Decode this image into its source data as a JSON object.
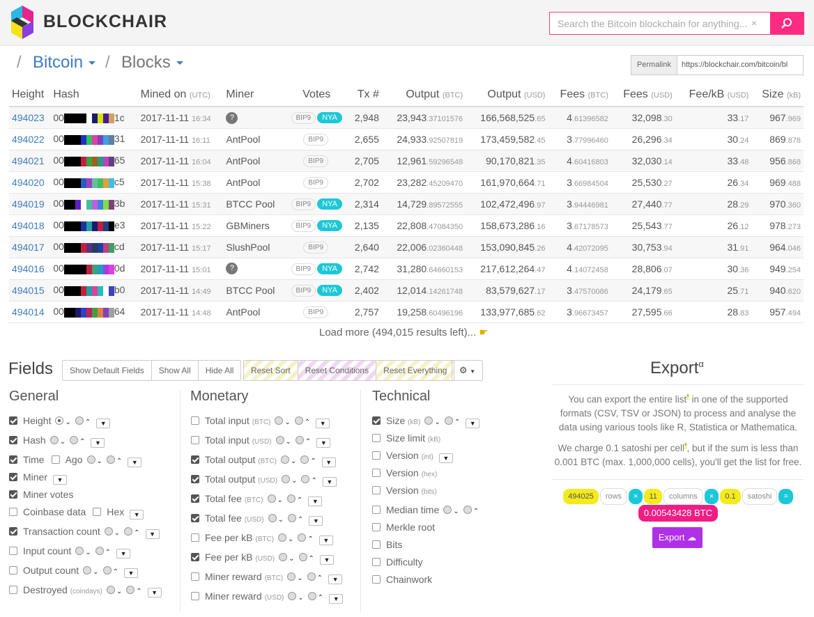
{
  "header": {
    "brand": "BLOCKCHAIR",
    "search_placeholder": "Search the Bitcoin blockchain for anything...",
    "clear": "×"
  },
  "breadcrumb": {
    "sep1": "/",
    "chain": "Bitcoin",
    "sep2": "/",
    "section": "Blocks"
  },
  "permalink": {
    "label": "Permalink",
    "url": "https://blockchair.com/bitcoin/bl"
  },
  "table": {
    "headers": [
      {
        "t": "Height",
        "u": ""
      },
      {
        "t": "Hash",
        "u": ""
      },
      {
        "t": "Mined on ",
        "u": "(UTC)"
      },
      {
        "t": "Miner",
        "u": ""
      },
      {
        "t": "Votes",
        "u": ""
      },
      {
        "t": "Tx #",
        "u": ""
      },
      {
        "t": "Output ",
        "u": "(BTC)"
      },
      {
        "t": "Output ",
        "u": "(USD)"
      },
      {
        "t": "Fees ",
        "u": "(BTC)"
      },
      {
        "t": "Fees ",
        "u": "(USD)"
      },
      {
        "t": "Fee/kB ",
        "u": "(USD)"
      },
      {
        "t": "Size ",
        "u": "(kB)"
      }
    ],
    "rows": [
      {
        "height": "494023",
        "hp": "00",
        "hs": "1c",
        "date": "2017-11-11",
        "time": "16:34",
        "miner": "?",
        "bip": "BIP9",
        "nya": "NYA",
        "tx": "2,948",
        "obi": "23,943",
        "obf": ".37101576",
        "oui": "166,568,525",
        "ouf": ".65",
        "fbi": "4",
        "fbf": ".61396582",
        "fui": "32,098",
        "fuf": ".30",
        "fki": "33",
        "fkf": ".17",
        "si": "967",
        "sf": ".969",
        "colors": [
          "#000",
          "#000",
          "#000",
          "#000",
          "#fff",
          "#1a1a6e",
          "#d4e000",
          "#4a1a8e",
          "#d4a060"
        ]
      },
      {
        "height": "494022",
        "hp": "00",
        "hs": "31",
        "date": "2017-11-11",
        "time": "16:11",
        "miner": "AntPool",
        "bip": "BIP9",
        "nya": "",
        "tx": "2,655",
        "obi": "24,933",
        "obf": ".92507819",
        "oui": "173,459,582",
        "ouf": ".45",
        "fbi": "3",
        "fbf": ".77996460",
        "fui": "26,296",
        "fuf": ".34",
        "fki": "30",
        "fkf": ".24",
        "si": "869",
        "sf": ".878",
        "colors": [
          "#000",
          "#000",
          "#000",
          "#2030c0",
          "#30c060",
          "#e040a0",
          "#8040c0",
          "#40a0e0",
          "#6080a0"
        ]
      },
      {
        "height": "494021",
        "hp": "00",
        "hs": "65",
        "date": "2017-11-11",
        "time": "16:04",
        "miner": "AntPool",
        "bip": "BIP9",
        "nya": "",
        "tx": "2,705",
        "obi": "12,961",
        "obf": ".59296548",
        "oui": "90,170,821",
        "ouf": ".35",
        "fbi": "4",
        "fbf": ".60416803",
        "fui": "32,030",
        "fuf": ".14",
        "fki": "33",
        "fkf": ".48",
        "si": "956",
        "sf": ".868",
        "colors": [
          "#000",
          "#000",
          "#000",
          "#c02040",
          "#40a040",
          "#a06020",
          "#20a080",
          "#c040c0",
          "#604080"
        ]
      },
      {
        "height": "494020",
        "hp": "00",
        "hs": "c5",
        "date": "2017-11-11",
        "time": "15:38",
        "miner": "AntPool",
        "bip": "BIP9",
        "nya": "",
        "tx": "2,702",
        "obi": "23,282",
        "obf": ".45209470",
        "oui": "161,970,664",
        "ouf": ".71",
        "fbi": "3",
        "fbf": ".66984504",
        "fui": "25,530",
        "fuf": ".27",
        "fki": "26",
        "fkf": ".34",
        "si": "969",
        "sf": ".488",
        "colors": [
          "#000",
          "#000",
          "#000",
          "#2060c0",
          "#a040c0",
          "#60c0a0",
          "#40c060",
          "#e0a040",
          "#40c0e0"
        ]
      },
      {
        "height": "494019",
        "hp": "00",
        "hs": "3b",
        "date": "2017-11-11",
        "time": "15:31",
        "miner": "BTCC Pool",
        "bip": "BIP9",
        "nya": "NYA",
        "tx": "2,314",
        "obi": "14,729",
        "obf": ".89572555",
        "oui": "102,472,496",
        "ouf": ".97",
        "fbi": "3",
        "fbf": ".94446981",
        "fui": "27,440",
        "fuf": ".77",
        "fki": "28",
        "fkf": ".29",
        "si": "970",
        "sf": ".360",
        "colors": [
          "#000",
          "#000",
          "#6020c0",
          "#fff",
          "#40c0a0",
          "#c060e0",
          "#4080e0",
          "#80e040",
          "#804080"
        ]
      },
      {
        "height": "494018",
        "hp": "00",
        "hs": "e3",
        "date": "2017-11-11",
        "time": "15:22",
        "miner": "GBMiners",
        "bip": "BIP9",
        "nya": "NYA",
        "tx": "2,135",
        "obi": "22,808",
        "obf": ".47084350",
        "oui": "158,673,286",
        "ouf": ".16",
        "fbi": "3",
        "fbf": ".67178573",
        "fui": "25,543",
        "fuf": ".77",
        "fki": "26",
        "fkf": ".12",
        "si": "978",
        "sf": ".273",
        "colors": [
          "#000",
          "#000",
          "#000",
          "#2030a0",
          "#20a0a0",
          "#1a1a6e",
          "#c02040",
          "#204080",
          "#000"
        ]
      },
      {
        "height": "494017",
        "hp": "00",
        "hs": "cd",
        "date": "2017-11-11",
        "time": "15:17",
        "miner": "SlushPool",
        "bip": "BIP9",
        "nya": "",
        "tx": "2,640",
        "obi": "22,006",
        "obf": ".02360448",
        "oui": "153,090,845",
        "ouf": ".26",
        "fbi": "4",
        "fbf": ".42072095",
        "fui": "30,753",
        "fuf": ".94",
        "fki": "31",
        "fkf": ".91",
        "si": "964",
        "sf": ".046",
        "colors": [
          "#000",
          "#000",
          "#000",
          "#c02040",
          "#603080",
          "#204060",
          "#2040a0",
          "#c04080",
          "#40a060"
        ]
      },
      {
        "height": "494016",
        "hp": "00",
        "hs": "0d",
        "date": "2017-11-11",
        "time": "15:01",
        "miner": "?",
        "bip": "BIP9",
        "nya": "NYA",
        "tx": "2,742",
        "obi": "31,280",
        "obf": ".64660153",
        "oui": "217,612,264",
        "ouf": ".47",
        "fbi": "4",
        "fbf": ".14072458",
        "fui": "28,806",
        "fuf": ".07",
        "fki": "30",
        "fkf": ".36",
        "si": "949",
        "sf": ".254",
        "colors": [
          "#000",
          "#000",
          "#000",
          "#000",
          "#c02040",
          "#40a080",
          "#20a0c0",
          "#a040e0",
          "#e040e0"
        ]
      },
      {
        "height": "494015",
        "hp": "00",
        "hs": "b0",
        "date": "2017-11-11",
        "time": "14:49",
        "miner": "BTCC Pool",
        "bip": "BIP9",
        "nya": "NYA",
        "tx": "2,402",
        "obi": "12,014",
        "obf": ".14261748",
        "oui": "83,579,627",
        "ouf": ".17",
        "fbi": "3",
        "fbf": ".47570086",
        "fui": "24,179",
        "fuf": ".65",
        "fki": "25",
        "fkf": ".71",
        "si": "940",
        "sf": ".620",
        "colors": [
          "#000",
          "#000",
          "#000",
          "#c02040",
          "#20a0a0",
          "#e040a0",
          "#20c0c0",
          "#fff",
          "#4040c0"
        ]
      },
      {
        "height": "494014",
        "hp": "00",
        "hs": "64",
        "date": "2017-11-11",
        "time": "14:48",
        "miner": "AntPool",
        "bip": "BIP9",
        "nya": "",
        "tx": "2,757",
        "obi": "19,258",
        "obf": ".60496196",
        "oui": "133,977,685",
        "ouf": ".62",
        "fbi": "3",
        "fbf": ".96673457",
        "fui": "27,595",
        "fuf": ".66",
        "fki": "28",
        "fkf": ".83",
        "si": "957",
        "sf": ".494",
        "colors": [
          "#000",
          "#000",
          "#1a1a6e",
          "#3040c0",
          "#c02060",
          "#40a040",
          "#e08040",
          "#8040c0",
          "#a0a0a0"
        ]
      }
    ]
  },
  "load_more": "Load more (494,015 results left)...",
  "fields": {
    "title": "Fields",
    "buttons": [
      "Show Default Fields",
      "Show All",
      "Hide All"
    ],
    "reset": [
      "Reset Sort",
      "Reset Conditions",
      "Reset Everything"
    ],
    "general_title": "General",
    "monetary_title": "Monetary",
    "technical_title": "Technical",
    "general": [
      {
        "n": "Height",
        "u": "",
        "c": true
      },
      {
        "n": "Hash",
        "u": "",
        "c": true
      },
      {
        "n": "Time",
        "u": "",
        "c": true,
        "ago": "Ago"
      },
      {
        "n": "Miner",
        "u": "",
        "c": true
      },
      {
        "n": "Miner votes",
        "u": "",
        "c": true
      },
      {
        "n": "Coinbase data",
        "u": "",
        "c": false,
        "hex": "Hex"
      },
      {
        "n": "Transaction count",
        "u": "",
        "c": true
      },
      {
        "n": "Input count",
        "u": "",
        "c": false
      },
      {
        "n": "Output count",
        "u": "",
        "c": false
      },
      {
        "n": "Destroyed",
        "u": "(coindays)",
        "c": false
      }
    ],
    "monetary": [
      {
        "n": "Total input",
        "u": "(BTC)",
        "c": false
      },
      {
        "n": "Total input",
        "u": "(USD)",
        "c": false
      },
      {
        "n": "Total output",
        "u": "(BTC)",
        "c": true
      },
      {
        "n": "Total output",
        "u": "(USD)",
        "c": true
      },
      {
        "n": "Total fee",
        "u": "(BTC)",
        "c": true
      },
      {
        "n": "Total fee",
        "u": "(USD)",
        "c": true
      },
      {
        "n": "Fee per kB",
        "u": "(BTC)",
        "c": false
      },
      {
        "n": "Fee per kB",
        "u": "(USD)",
        "c": true
      },
      {
        "n": "Miner reward",
        "u": "(BTC)",
        "c": false
      },
      {
        "n": "Miner reward",
        "u": "(USD)",
        "c": false
      }
    ],
    "technical": [
      {
        "n": "Size",
        "u": "(kB)",
        "c": true
      },
      {
        "n": "Size limit",
        "u": "(kB)",
        "c": false
      },
      {
        "n": "Version",
        "u": "(int)",
        "c": false
      },
      {
        "n": "Version",
        "u": "(hex)",
        "c": false
      },
      {
        "n": "Version",
        "u": "(bits)",
        "c": false
      },
      {
        "n": "Median time",
        "u": "",
        "c": false
      },
      {
        "n": "Merkle root",
        "u": "",
        "c": false
      },
      {
        "n": "Bits",
        "u": "",
        "c": false
      },
      {
        "n": "Difficulty",
        "u": "",
        "c": false
      },
      {
        "n": "Chainwork",
        "u": "",
        "c": false
      }
    ]
  },
  "export": {
    "title": "Export",
    "sup": "α",
    "p1a": "You can export the entire list",
    "mark": "*",
    "p1b": " in one of the supported formats (CSV, TSV or JSON) to process and analyse the data using various tools like R, Statistica or Mathematica.",
    "p2a": "We charge 0.1 satoshi per cell",
    "p2b": ", but if the sum is less than 0.001 BTC (max. 1,000,000 cells), you'll get the list for free.",
    "rows_n": "494025",
    "rows_l": "rows",
    "times": "×",
    "cols_n": "11",
    "cols_l": "columns",
    "sat_n": "0.1",
    "sat_l": "satoshi",
    "eq": "=",
    "total": "0.00543428 BTC",
    "button": "Export"
  },
  "colors": {
    "accent": "#ff2a82",
    "link": "#3d7cc0",
    "nya": "#1cc8d8",
    "export": "#b030e8"
  }
}
